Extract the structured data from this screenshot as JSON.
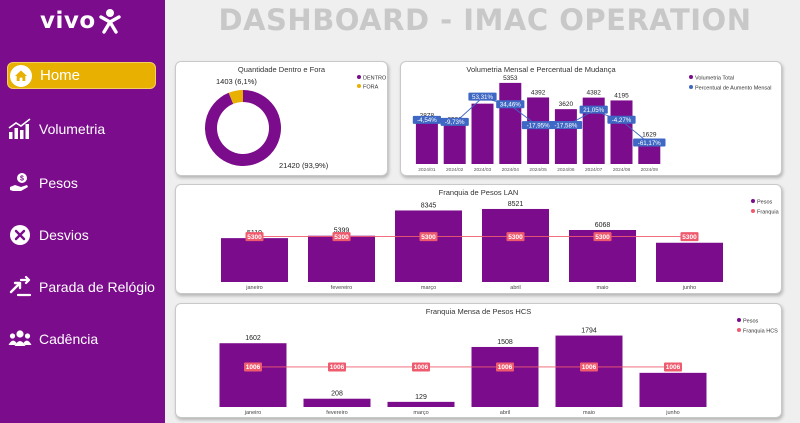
{
  "app": {
    "logo_text": "vivo",
    "dashboard_title": "DASHBOARD - IMAC OPERATION"
  },
  "colors": {
    "purple": "#7b0c8c",
    "gold": "#e8b000",
    "line_red": "#ef5b6e",
    "blue": "#3f67c4"
  },
  "sidebar": {
    "items": [
      {
        "label": "Home",
        "icon": "home-icon",
        "active": true
      },
      {
        "label": "Volumetria",
        "icon": "bar-chart-icon",
        "active": false
      },
      {
        "label": "Pesos",
        "icon": "hand-money-icon",
        "active": false
      },
      {
        "label": "Desvios",
        "icon": "close-circle-icon",
        "active": false
      },
      {
        "label": "Parada de Relógio",
        "icon": "arrows-swap-icon",
        "active": false
      },
      {
        "label": "Cadência",
        "icon": "people-icon",
        "active": false
      }
    ]
  },
  "chart_data": [
    {
      "type": "pie",
      "title": "Quantidade Dentro e Fora",
      "labels": [
        "DENTRO",
        "FORA"
      ],
      "values": [
        21420,
        1403
      ],
      "data_labels": [
        "21420 (93,9%)",
        "1403 (6,1%)"
      ],
      "colors": [
        "#7b0c8c",
        "#e8b000"
      ],
      "legend_position": "right"
    },
    {
      "type": "bar",
      "title": "Volumetria Mensal e Percentual de Mudança",
      "categories": [
        "2024/01",
        "2024/02",
        "2024/03",
        "2024/04",
        "2024/05",
        "2024/06",
        "2024/07",
        "2024/08",
        "2024/09"
      ],
      "series": [
        {
          "name": "Volumetria Total",
          "type": "bar",
          "values": [
            2878,
            2598,
            3983,
            5353,
            4392,
            3620,
            4382,
            4195,
            1629
          ]
        },
        {
          "name": "Percentual de Aumento Mensal",
          "type": "line",
          "values": [
            -4.54,
            -9.73,
            53.31,
            34.46,
            -17.95,
            -17.58,
            21.05,
            -4.27,
            -61.17
          ],
          "data_labels": [
            "-4,54%",
            "-9,73%",
            "53,31%",
            "34,46%",
            "-17,95%",
            "-17,58%",
            "21,05%",
            "-4,27%",
            "-61,17%"
          ]
        }
      ],
      "legend_position": "right"
    },
    {
      "type": "bar",
      "title": "Franquia de Pesos LAN",
      "categories": [
        "janeiro",
        "fevereiro",
        "março",
        "abril",
        "maio",
        "junho"
      ],
      "series": [
        {
          "name": "Pesos",
          "type": "bar",
          "values": [
            5119,
            5399,
            8345,
            8521,
            6068,
            4579
          ]
        },
        {
          "name": "Franquia",
          "type": "line",
          "values": [
            5300,
            5300,
            5300,
            5300,
            5300,
            5300
          ]
        }
      ],
      "legend_position": "top-right"
    },
    {
      "type": "bar",
      "title": "Franquia Mensa de Pesos HCS",
      "categories": [
        "janeiro",
        "fevereiro",
        "março",
        "abril",
        "maio",
        "junho"
      ],
      "series": [
        {
          "name": "Pesos",
          "type": "bar",
          "values": [
            1602,
            208,
            129,
            1508,
            1794,
            858
          ]
        },
        {
          "name": "Franquia HCS",
          "type": "line",
          "values": [
            1006,
            1006,
            1006,
            1006,
            1006,
            1006
          ]
        }
      ],
      "legend_position": "top-right"
    }
  ]
}
